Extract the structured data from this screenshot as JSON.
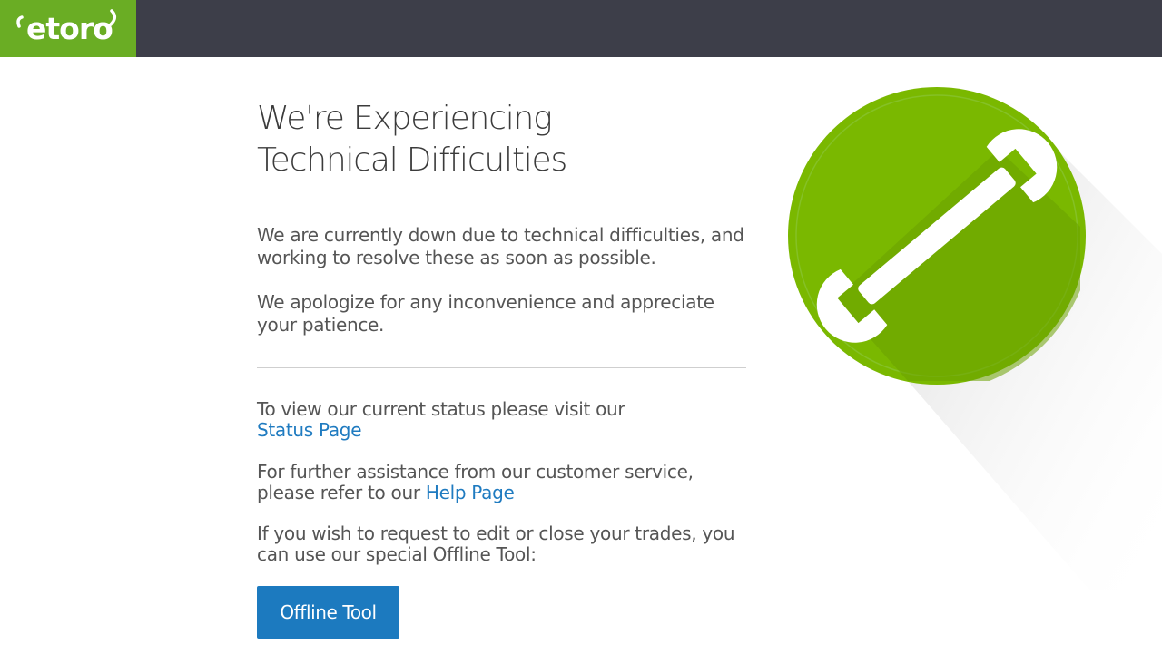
{
  "header": {
    "logo_text": "etoro",
    "colors": {
      "bar": "#3d3e49",
      "logo_bg": "#6aad24"
    }
  },
  "main": {
    "title_line1": "We're Experiencing",
    "title_line2": "Technical Difficulties",
    "para1": "We are currently down due to technical difficulties, and working to resolve these as soon as possible.",
    "para2": "We apologize for any inconvenience and appreciate your patience.",
    "status_text": "To view our current status please visit our",
    "status_link": "Status Page",
    "help_text": "For further assistance from our customer service, please refer to our",
    "help_link": "Help Page",
    "offline_text": "If you wish to request to edit or close your trades, you can use our special Offline Tool:",
    "offline_button": "Offline Tool"
  },
  "illustration": {
    "icon": "wrench-icon",
    "colors": {
      "circle": "#7ab800",
      "shadow": "#e6e6e6",
      "wrench": "#ffffff"
    }
  },
  "accent_color": "#1c7abf"
}
